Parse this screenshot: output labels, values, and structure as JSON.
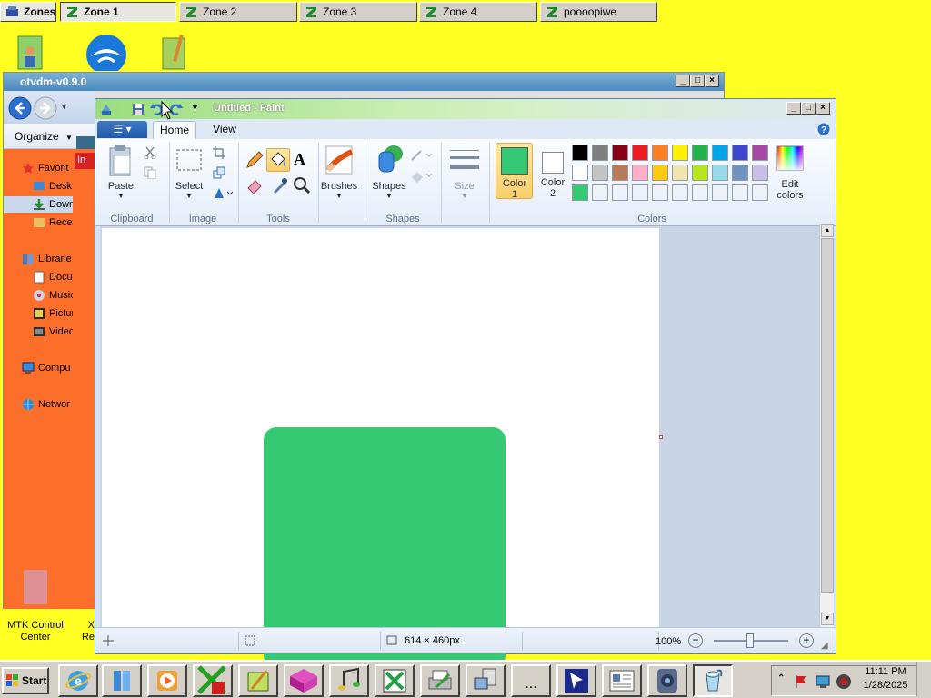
{
  "zonebar": {
    "menu_label": "Zones",
    "tabs": [
      {
        "label": "Zone 1",
        "active": true
      },
      {
        "label": "Zone 2",
        "active": false
      },
      {
        "label": "Zone 3",
        "active": false
      },
      {
        "label": "Zone 4",
        "active": false
      },
      {
        "label": "poooopiwe",
        "active": false
      }
    ]
  },
  "desktop": {
    "bottom_icon_label_1": "MTK Control",
    "bottom_icon_label_2": "Center",
    "bottom_icon_label_right_1": "X",
    "bottom_icon_label_right_2": "Re"
  },
  "otvdm": {
    "title": "otvdm-v0.9.0"
  },
  "explorer": {
    "organize_label": "Organize",
    "red_tab_label": "In",
    "nav_items": [
      {
        "label": "Favorit",
        "icon": "star-icon"
      },
      {
        "label": "Desk",
        "icon": "desktop-icon"
      },
      {
        "label": "Down",
        "icon": "download-icon",
        "selected": true
      },
      {
        "label": "Rece",
        "icon": "recent-icon"
      },
      {
        "label": "Librarie",
        "icon": "library-icon"
      },
      {
        "label": "Docu",
        "icon": "documents-icon"
      },
      {
        "label": "Music",
        "icon": "music-icon"
      },
      {
        "label": "Pictur",
        "icon": "pictures-icon"
      },
      {
        "label": "Video",
        "icon": "video-icon"
      },
      {
        "label": "Compu",
        "icon": "computer-icon"
      },
      {
        "label": "Networ",
        "icon": "network-icon"
      }
    ]
  },
  "paint": {
    "title": "Untitled - Paint",
    "tabs": {
      "home": "Home",
      "view": "View"
    },
    "groups": {
      "clipboard": "Clipboard",
      "image": "Image",
      "tools": "Tools",
      "shapes": "Shapes",
      "colors": "Colors"
    },
    "buttons": {
      "paste": "Paste",
      "select": "Select",
      "brushes": "Brushes",
      "shapes": "Shapes",
      "size": "Size",
      "color1_line1": "Color",
      "color1_line2": "1",
      "color2_line1": "Color",
      "color2_line2": "2",
      "edit_colors_line1": "Edit",
      "edit_colors_line2": "colors"
    },
    "color1": "#35c974",
    "color2": "#ffffff",
    "palette": [
      "#000000",
      "#7f7f7f",
      "#880015",
      "#ed1c24",
      "#ff7f27",
      "#fff200",
      "#22b14c",
      "#00a2e8",
      "#3f48cc",
      "#a349a4",
      "#ffffff",
      "#c3c3c3",
      "#b97a57",
      "#ffaec9",
      "#ffc90e",
      "#efe4b0",
      "#b5e61d",
      "#99d9ea",
      "#7092be",
      "#c8bfe7",
      "#35c974",
      "#eef3f9",
      "#eef3f9",
      "#eef3f9",
      "#eef3f9",
      "#eef3f9",
      "#eef3f9",
      "#eef3f9",
      "#eef3f9",
      "#eef3f9"
    ],
    "shape_fill": "#35c974",
    "status": {
      "canvas_size": "614 × 460px",
      "zoom": "100%"
    }
  },
  "taskbar": {
    "start_label": "Start",
    "clock_time": "11:11 PM",
    "clock_date": "1/28/2025",
    "ellipsis_label": "..."
  }
}
